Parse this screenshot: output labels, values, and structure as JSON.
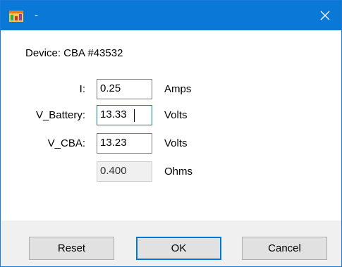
{
  "window": {
    "title": "-",
    "close_glyph": "✕"
  },
  "device": {
    "label": "Device: CBA #43532"
  },
  "fields": {
    "current": {
      "label": "I:",
      "value": "0.25",
      "unit": "Amps"
    },
    "v_battery": {
      "label": "V_Battery:",
      "value": "13.33",
      "unit": "Volts"
    },
    "v_cba": {
      "label": "V_CBA:",
      "value": "13.23",
      "unit": "Volts"
    },
    "resistance": {
      "label": "",
      "value": "0.400",
      "unit": "Ohms"
    }
  },
  "buttons": {
    "reset": "Reset",
    "ok": "OK",
    "cancel": "Cancel"
  },
  "colors": {
    "titlebar": "#0a78d7",
    "focus_border": "#0078d7",
    "footer": "#f0f0f0"
  },
  "icons": {
    "app": "app-icon",
    "close": "close-icon"
  }
}
